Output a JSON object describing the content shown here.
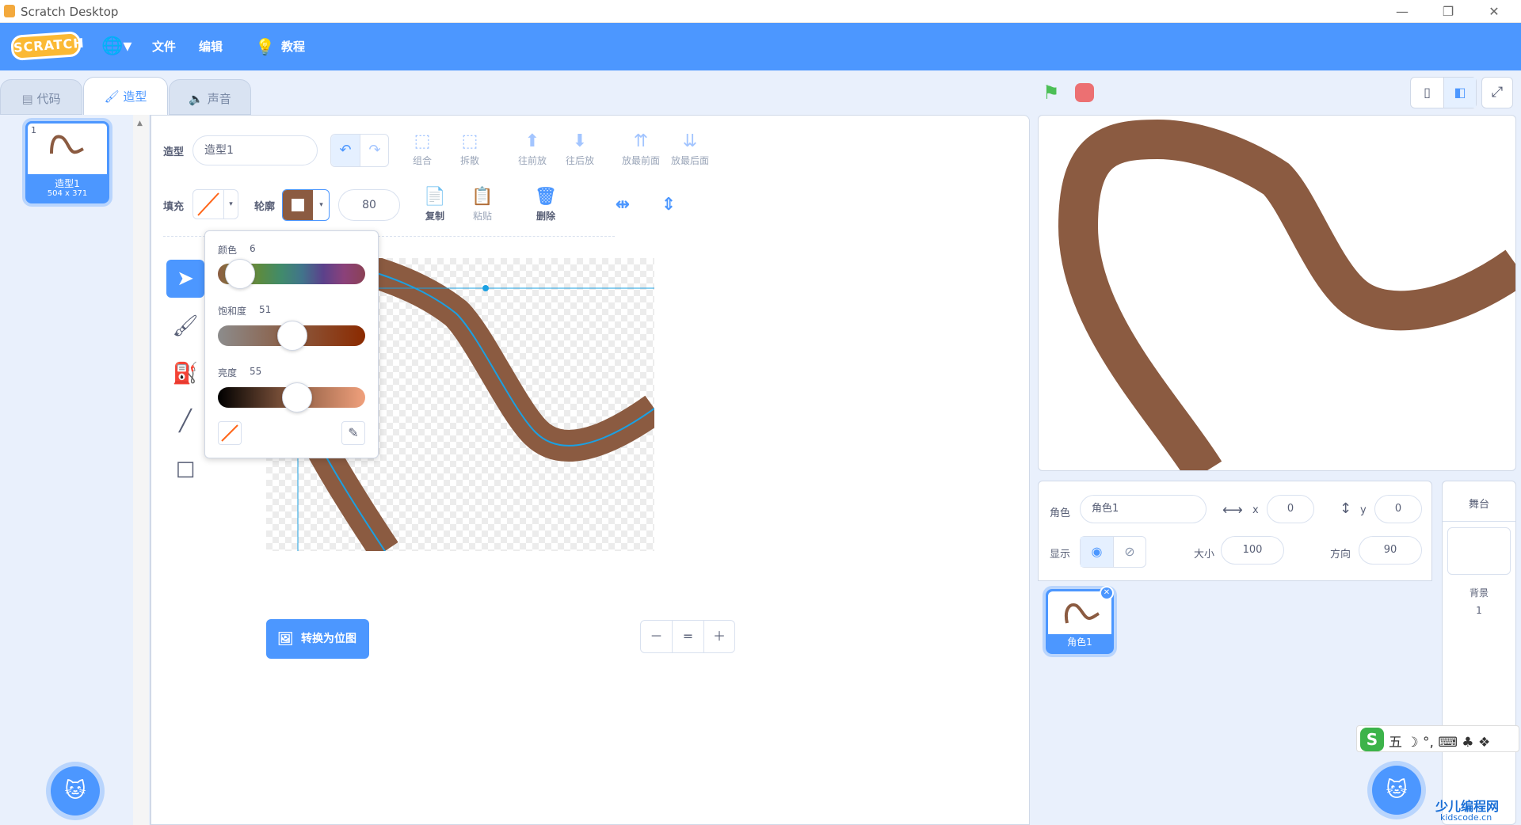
{
  "window": {
    "title": "Scratch Desktop",
    "minimize": "—",
    "restore": "❐",
    "close": "✕"
  },
  "menubar": {
    "logo": "SCRATCH",
    "file": "文件",
    "edit": "编辑",
    "tutorials": "教程"
  },
  "tabs": {
    "code": "代码",
    "costumes": "造型",
    "sounds": "声音"
  },
  "costume_list": {
    "items": [
      {
        "index": "1",
        "name": "造型1",
        "size": "504 x 371"
      }
    ]
  },
  "paint": {
    "costume_label": "造型",
    "costume_name": "造型1",
    "fill_label": "填充",
    "outline_label": "轮廓",
    "outline_width": "80",
    "buttons": {
      "group": "组合",
      "ungroup": "拆散",
      "forward": "往前放",
      "backward": "往后放",
      "front": "放最前面",
      "back": "放最后面",
      "copy": "复制",
      "paste": "粘贴",
      "delete": "删除"
    },
    "picker": {
      "color_label": "颜色",
      "color_value": "6",
      "color_level": 0.06,
      "saturation_label": "饱和度",
      "saturation_value": "51",
      "saturation_level": 0.51,
      "brightness_label": "亮度",
      "brightness_value": "55",
      "brightness_level": 0.55
    },
    "convert_button": "转换为位图",
    "zoom": {
      "out": "－",
      "reset": "=",
      "in": "＋"
    }
  },
  "sprite_info": {
    "sprite_label": "角色",
    "sprite_name": "角色1",
    "x_label": "x",
    "x_value": "0",
    "y_label": "y",
    "y_value": "0",
    "show_label": "显示",
    "size_label": "大小",
    "size_value": "100",
    "direction_label": "方向",
    "direction_value": "90"
  },
  "sprites": [
    {
      "name": "角色1"
    }
  ],
  "stage_panel": {
    "title": "舞台",
    "backdrops_label": "背景",
    "backdrops_count": "1"
  },
  "ime": {
    "glyphs": "五 ☽ °, ⌨ ♣ ❖"
  },
  "watermark": {
    "text": "少儿编程网",
    "sub": "kidscode.cn"
  },
  "colors": {
    "accent": "#4c97ff",
    "stroke": "#8b5b41",
    "green_flag": "#4cbf56",
    "stop": "#ec5959"
  }
}
